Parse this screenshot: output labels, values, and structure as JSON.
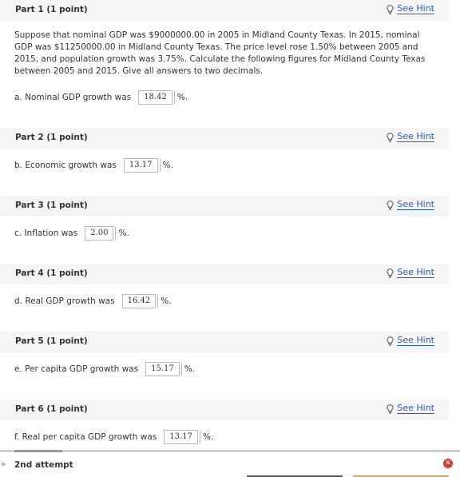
{
  "parts": [
    {
      "title": "Part 1   (1 point)",
      "hint_label": "See Hint"
    },
    {
      "title": "Part 2   (1 point)",
      "hint_label": "See Hint"
    },
    {
      "title": "Part 3   (1 point)",
      "hint_label": "See Hint"
    },
    {
      "title": "Part 4   (1 point)",
      "hint_label": "See Hint"
    },
    {
      "title": "Part 5   (1 point)",
      "hint_label": "See Hint"
    },
    {
      "title": "Part 6   (1 point)",
      "hint_label": "See Hint"
    }
  ],
  "problem_text": "Suppose that nominal GDP was $9000000.00 in 2005 in Midland County Texas. In 2015, nominal GDP was $11250000.00 in Midland County Texas. The price level rose 1.50% between 2005 and 2015, and population growth was 3.75%. Calculate the following figures for Midland County Texas between 2005 and 2015. Give all answers to two decimals.",
  "questions": [
    {
      "label": "a. Nominal GDP growth was",
      "value": "18.42",
      "unit": "%."
    },
    {
      "label": "b. Economic growth was",
      "value": "13.17",
      "unit": "%."
    },
    {
      "label": "c. Inflation was",
      "value": "2.00",
      "unit": "%."
    },
    {
      "label": "d. Real GDP growth was",
      "value": "16.42",
      "unit": "%."
    },
    {
      "label": "e. Per capita GDP growth was",
      "value": "15.17",
      "unit": "%."
    },
    {
      "label": "f. Real per capita GDP growth was",
      "value": "13.17",
      "unit": "%."
    }
  ],
  "attempt_label": "2nd attempt",
  "colors": {
    "link": "#2a5db0",
    "error": "#d93a2b",
    "accent_bar": "#e8a531"
  },
  "icons": {
    "hint": "lightbulb-icon",
    "status": "close-circle-icon",
    "attempt_toggle": "caret-right-icon"
  }
}
